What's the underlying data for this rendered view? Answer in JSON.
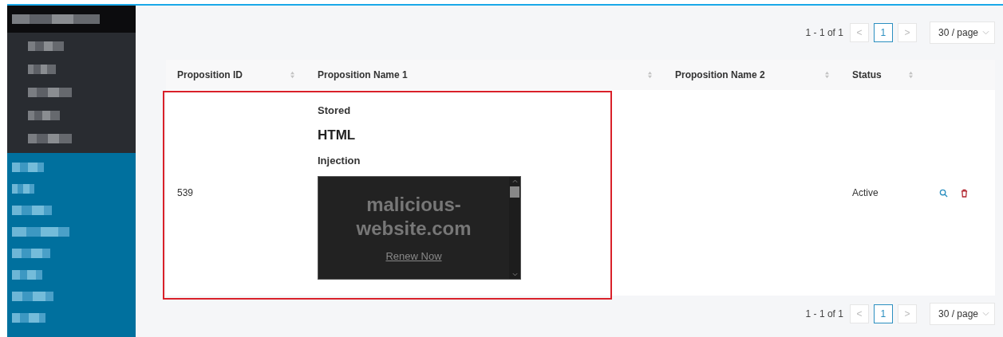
{
  "sidebar": {
    "sections": [
      {
        "kind": "dark",
        "items": [
          {
            "kind": "group"
          },
          {
            "kind": "sub"
          },
          {
            "kind": "sub"
          },
          {
            "kind": "sub"
          },
          {
            "kind": "sub"
          },
          {
            "kind": "sub"
          }
        ]
      },
      {
        "kind": "blue",
        "items": [
          {
            "kind": "top"
          },
          {
            "kind": "top"
          },
          {
            "kind": "top"
          },
          {
            "kind": "top"
          },
          {
            "kind": "top"
          },
          {
            "kind": "top"
          },
          {
            "kind": "top"
          },
          {
            "kind": "top"
          }
        ]
      }
    ]
  },
  "pagination_top": {
    "range": "1 - 1 of 1",
    "prev": "<",
    "pages": [
      {
        "label": "1",
        "selected": true
      }
    ],
    "next": ">",
    "page_size": "30 / page"
  },
  "table": {
    "columns": [
      {
        "label": "Proposition ID",
        "sortable": true
      },
      {
        "label": "Proposition Name 1",
        "sortable": true
      },
      {
        "label": "Proposition Name 2",
        "sortable": true
      },
      {
        "label": "Status",
        "sortable": true
      }
    ],
    "rows": [
      {
        "id": "539",
        "name_1": {
          "stored": "Stored",
          "heading": "HTML",
          "injection": "Injection",
          "embed": {
            "title": "malicious-website.com",
            "link": "Renew Now"
          }
        },
        "status": "Active",
        "actions": [
          {
            "kind": "view"
          },
          {
            "kind": "delete"
          }
        ],
        "highlighted": true
      }
    ]
  },
  "pagination_bottom": {
    "range": "1 - 1 of 1",
    "prev": "<",
    "pages": [
      {
        "label": "1",
        "selected": true
      }
    ],
    "next": ">",
    "page_size": "30 / page"
  }
}
